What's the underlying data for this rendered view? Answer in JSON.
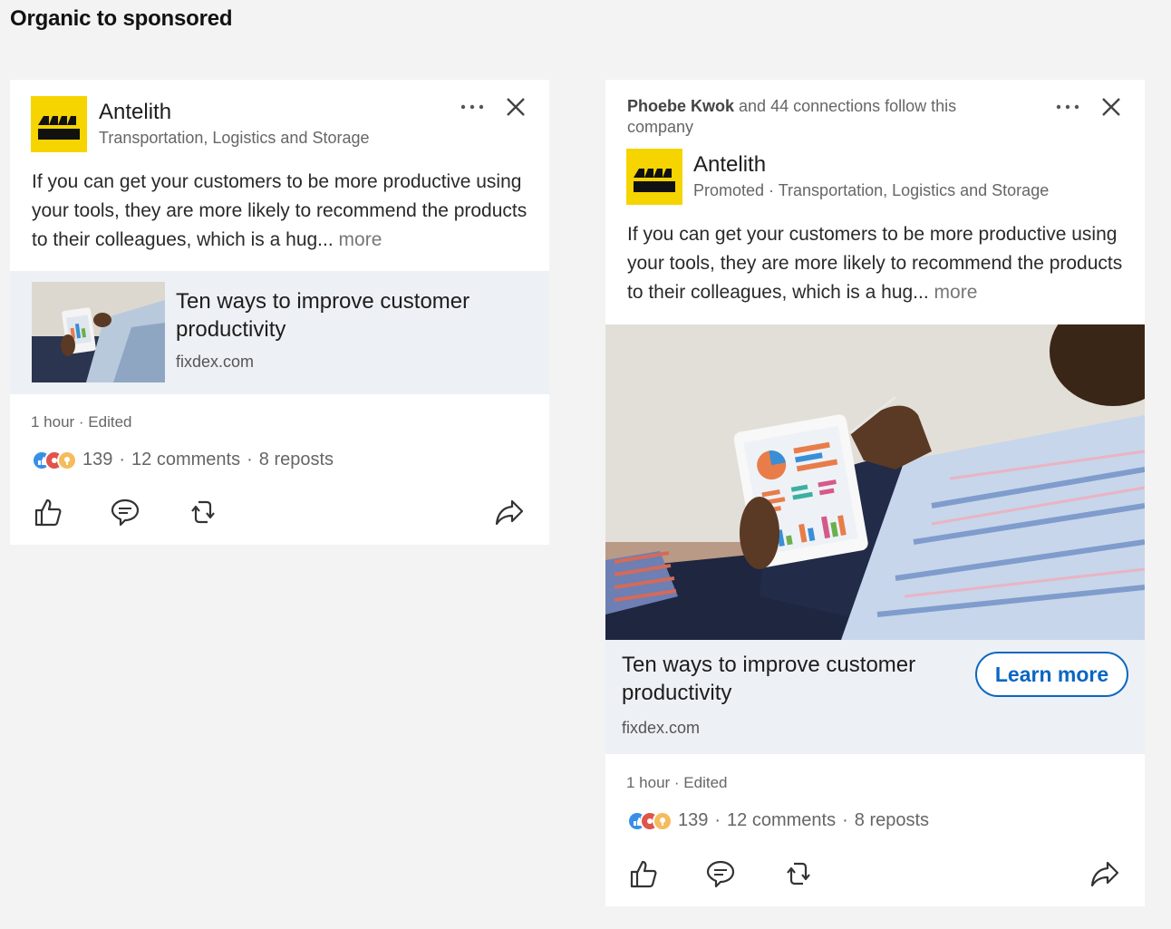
{
  "page": {
    "title": "Organic to sponsored"
  },
  "organic": {
    "company": "Antelith",
    "subtitle": "Transportation, Logistics and Storage",
    "body": "If you can get your customers to be more productive using your tools, they are more likely to recommend the products to their colleagues, which is a hug...",
    "more_label": "more",
    "link": {
      "title": "Ten ways to improve customer productivity",
      "domain": "fixdex.com"
    },
    "meta": "1 hour · Edited",
    "reactions": {
      "count": "139",
      "comments": "12 comments",
      "reposts": "8 reposts",
      "sep": "·"
    }
  },
  "sponsored": {
    "social_proof": {
      "name": "Phoebe Kwok",
      "rest": " and 44 connections follow this company"
    },
    "company": "Antelith",
    "subtitle": "Promoted · Transportation, Logistics and Storage",
    "body": "If you can get your customers to be more productive using your tools, they are more likely to recommend the products to their colleagues, which is a hug...",
    "more_label": "more",
    "link": {
      "title": "Ten ways to improve customer productivity",
      "domain": "fixdex.com",
      "cta": "Learn more"
    },
    "meta": "1 hour · Edited",
    "reactions": {
      "count": "139",
      "comments": "12 comments",
      "reposts": "8 reposts",
      "sep": "·"
    }
  },
  "icons": {
    "logo": "factory-logo",
    "menu": "more-dots-icon",
    "close": "close-icon",
    "like": "thumbs-up-icon",
    "comment": "comment-icon",
    "repost": "repost-icon",
    "send": "send-icon"
  },
  "colors": {
    "accent": "#0a66c2",
    "logo_bg": "#f5d400",
    "preview_bg": "#edf0f4"
  }
}
